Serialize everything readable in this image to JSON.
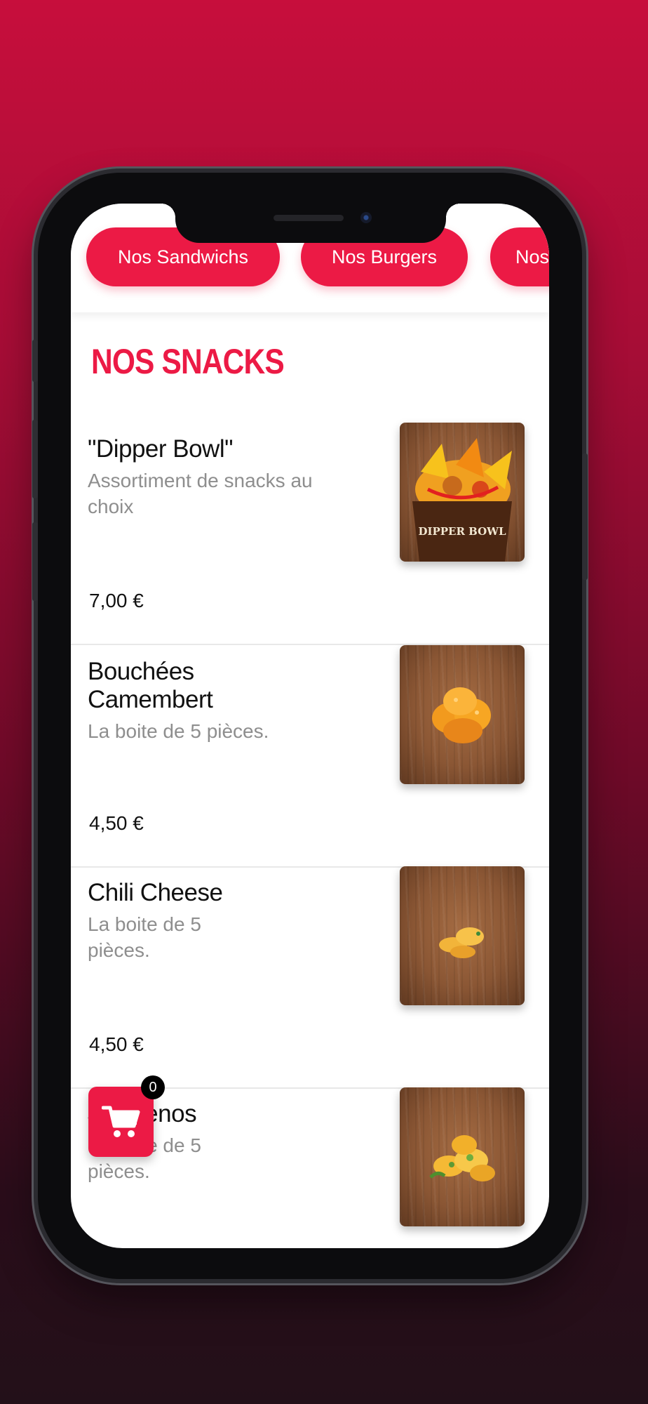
{
  "categories": [
    {
      "label": "Nos Sandwichs"
    },
    {
      "label": "Nos Burgers"
    },
    {
      "label": "Nos"
    }
  ],
  "section_title": "NOS SNACKS",
  "items": [
    {
      "name": "\"Dipper Bowl\"",
      "description": "Assortiment de snacks au choix",
      "price": "7,00 €",
      "image_caption": "DIPPER BOWL"
    },
    {
      "name": "Bouchées Camembert",
      "description": "La boite de 5 pièces.",
      "price": "4,50 €"
    },
    {
      "name": "Chili Cheese",
      "description": "La boite de 5 pièces.",
      "price": "4,50 €"
    },
    {
      "name": "Jalapenos",
      "description": "La boite de 5 pièces."
    }
  ],
  "cart": {
    "count": "0",
    "icon": "cart-icon"
  },
  "colors": {
    "accent": "#ec1a45",
    "background_top": "#c70e3c",
    "background_bottom": "#231019"
  }
}
